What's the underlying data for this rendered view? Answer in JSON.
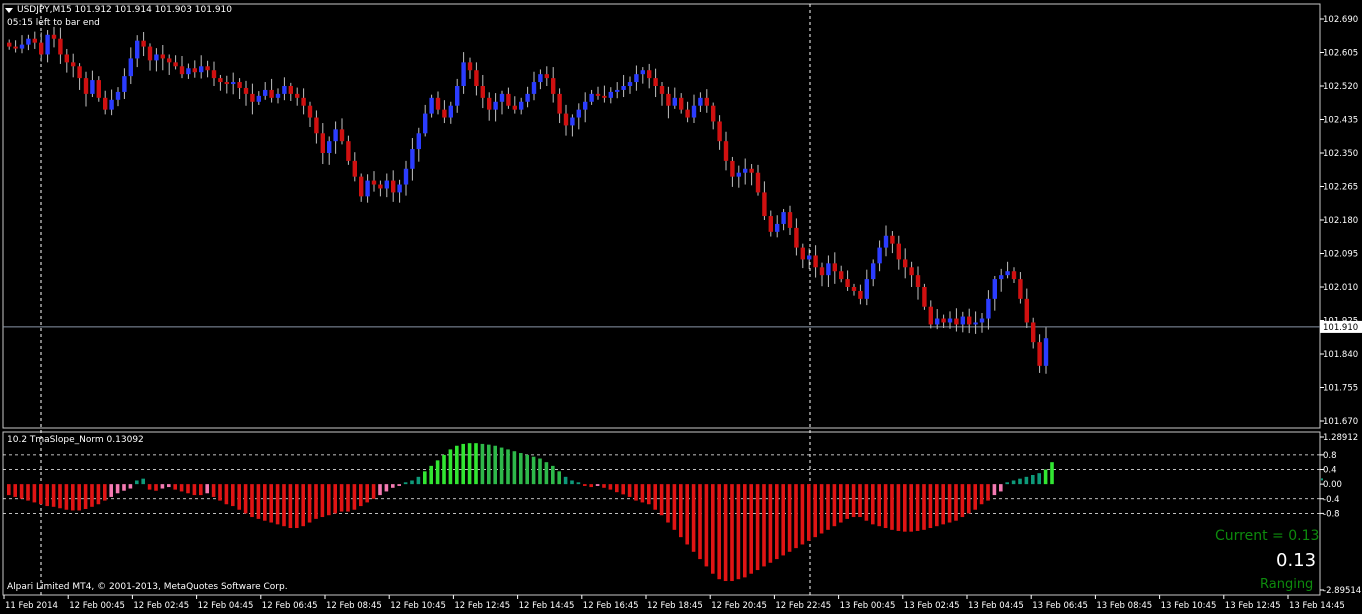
{
  "header": {
    "symbol_line": "USDJPY,M15  101.912 101.914 101.903 101.910",
    "timer": "05:15 left to bar end"
  },
  "indicator": {
    "title": "10.2 TmaSlope_Norm 0.13092",
    "current_label": "Current = 0.13",
    "big_value": "0.13",
    "state": "Ranging"
  },
  "footer": {
    "broker": "Alpari Limited MT4, © 2001-2013, MetaQuotes Software Corp."
  },
  "colors": {
    "bull": "#2b3cff",
    "bear": "#d01010",
    "pos_strong": "#32e632",
    "pos_weak": "#0e9a7a",
    "neg_strong": "#e01414",
    "neg_weak": "#f47ab2",
    "current_price_line": "#8a96a8",
    "grid_dash": "#ffffff"
  },
  "chart_data": [
    {
      "type": "candlestick",
      "title": "USDJPY,M15",
      "ylim": [
        101.67,
        102.77
      ],
      "y_ticks": [
        "102.690",
        "102.605",
        "102.520",
        "102.435",
        "102.350",
        "102.265",
        "102.180",
        "102.095",
        "102.010",
        "101.925",
        "101.840",
        "101.755",
        "101.670"
      ],
      "current_price": "101.910",
      "x_tick_labels": [
        "11 Feb 2014",
        "12 Feb 00:45",
        "12 Feb 02:45",
        "12 Feb 04:45",
        "12 Feb 06:45",
        "12 Feb 08:45",
        "12 Feb 10:45",
        "12 Feb 12:45",
        "12 Feb 14:45",
        "12 Feb 16:45",
        "12 Feb 18:45",
        "12 Feb 20:45",
        "12 Feb 22:45",
        "13 Feb 00:45",
        "13 Feb 02:45",
        "13 Feb 04:45",
        "13 Feb 06:45",
        "13 Feb 08:45",
        "13 Feb 10:45",
        "13 Feb 12:45",
        "13 Feb 14:45"
      ],
      "closes": [
        102.62,
        102.615,
        102.625,
        102.64,
        102.63,
        102.6,
        102.65,
        102.64,
        102.6,
        102.58,
        102.57,
        102.54,
        102.5,
        102.535,
        102.49,
        102.46,
        102.485,
        102.505,
        102.545,
        102.59,
        102.635,
        102.62,
        102.585,
        102.6,
        102.59,
        102.58,
        102.57,
        102.55,
        102.565,
        102.555,
        102.57,
        102.56,
        102.54,
        102.53,
        102.525,
        102.53,
        102.515,
        102.5,
        102.48,
        102.495,
        102.51,
        102.49,
        102.5,
        102.52,
        102.5,
        102.49,
        102.47,
        102.44,
        102.4,
        102.35,
        102.38,
        102.41,
        102.38,
        102.33,
        102.29,
        102.24,
        102.28,
        102.27,
        102.26,
        102.28,
        102.25,
        102.27,
        102.31,
        102.36,
        102.4,
        102.45,
        102.49,
        102.46,
        102.44,
        102.47,
        102.52,
        102.58,
        102.56,
        102.52,
        102.49,
        102.46,
        102.48,
        102.5,
        102.47,
        102.46,
        102.48,
        102.5,
        102.53,
        102.55,
        102.54,
        102.5,
        102.45,
        102.42,
        102.44,
        102.46,
        102.48,
        102.5,
        102.495,
        102.49,
        102.505,
        102.51,
        102.52,
        102.53,
        102.55,
        102.56,
        102.54,
        102.52,
        102.5,
        102.47,
        102.49,
        102.46,
        102.44,
        102.47,
        102.49,
        102.47,
        102.43,
        102.38,
        102.33,
        102.29,
        102.3,
        102.31,
        102.3,
        102.25,
        102.19,
        102.15,
        102.17,
        102.2,
        102.16,
        102.11,
        102.08,
        102.09,
        102.06,
        102.04,
        102.07,
        102.05,
        102.03,
        102.01,
        102.0,
        101.98,
        102.03,
        102.07,
        102.11,
        102.14,
        102.12,
        102.08,
        102.06,
        102.04,
        102.01,
        101.96,
        101.915,
        101.93,
        101.92,
        101.93,
        101.915,
        101.935,
        101.915,
        101.92,
        101.93,
        101.98,
        102.03,
        102.04,
        102.05,
        102.03,
        101.98,
        101.92,
        101.87,
        101.81,
        101.88
      ]
    },
    {
      "type": "bar",
      "title": "10.2 TmaSlope_Norm 0.13092",
      "ylim": [
        -2.89514,
        1.28912
      ],
      "y_ticks": [
        "1.28912",
        "0.8",
        "0.4",
        "0.00",
        "-0.4",
        "-0.8",
        "-2.89514"
      ],
      "levels": [
        0.8,
        0.4,
        -0.4,
        -0.8
      ],
      "values": [
        -0.3,
        -0.35,
        -0.4,
        -0.45,
        -0.5,
        -0.55,
        -0.6,
        -0.62,
        -0.66,
        -0.7,
        -0.72,
        -0.72,
        -0.68,
        -0.62,
        -0.55,
        -0.45,
        -0.35,
        -0.25,
        -0.18,
        -0.12,
        0.1,
        0.15,
        -0.15,
        -0.18,
        -0.12,
        -0.08,
        -0.15,
        -0.2,
        -0.25,
        -0.3,
        -0.3,
        -0.25,
        -0.35,
        -0.45,
        -0.55,
        -0.6,
        -0.7,
        -0.8,
        -0.9,
        -0.95,
        -1.0,
        -1.05,
        -1.1,
        -1.15,
        -1.2,
        -1.2,
        -1.15,
        -1.05,
        -0.95,
        -0.9,
        -0.85,
        -0.8,
        -0.75,
        -0.75,
        -0.7,
        -0.6,
        -0.5,
        -0.4,
        -0.3,
        -0.2,
        -0.1,
        -0.05,
        0.05,
        0.1,
        0.2,
        0.35,
        0.5,
        0.65,
        0.8,
        0.95,
        1.05,
        1.1,
        1.12,
        1.12,
        1.1,
        1.08,
        1.05,
        1.0,
        0.95,
        0.9,
        0.85,
        0.8,
        0.75,
        0.7,
        0.6,
        0.5,
        0.35,
        0.2,
        0.1,
        0.05,
        -0.05,
        -0.08,
        -0.05,
        -0.1,
        -0.15,
        -0.22,
        -0.28,
        -0.35,
        -0.45,
        -0.5,
        -0.55,
        -0.7,
        -0.85,
        -1.05,
        -1.25,
        -1.45,
        -1.65,
        -1.85,
        -2.05,
        -2.25,
        -2.45,
        -2.6,
        -2.65,
        -2.65,
        -2.6,
        -2.55,
        -2.45,
        -2.35,
        -2.25,
        -2.15,
        -2.05,
        -1.95,
        -1.85,
        -1.75,
        -1.65,
        -1.55,
        -1.45,
        -1.35,
        -1.25,
        -1.15,
        -1.05,
        -0.95,
        -0.9,
        -0.9,
        -1.0,
        -1.1,
        -1.15,
        -1.2,
        -1.25,
        -1.28,
        -1.3,
        -1.3,
        -1.28,
        -1.25,
        -1.2,
        -1.15,
        -1.1,
        -1.05,
        -1.0,
        -0.9,
        -0.8,
        -0.7,
        -0.55,
        -0.45,
        -0.3,
        -0.2,
        0.05,
        0.1,
        0.15,
        0.2,
        0.25,
        0.3,
        0.4,
        0.6
      ],
      "last_value": 0.13
    }
  ]
}
